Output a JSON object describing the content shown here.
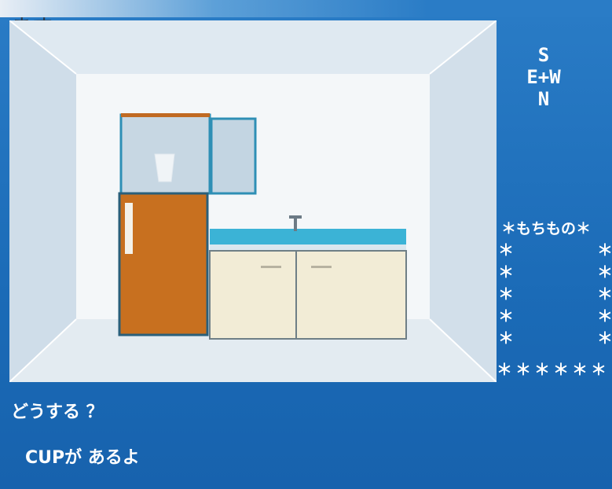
{
  "header": {
    "text": "ます。"
  },
  "compass": {
    "top": "S",
    "middle": "E+W",
    "bottom": "N"
  },
  "inventory": {
    "title": "＊もちもの＊",
    "star": "＊",
    "bottom": "＊＊＊＊＊＊"
  },
  "messages": {
    "prompt": "どうする ？",
    "result": "CUPが あるよ"
  },
  "colors": {
    "screen_blue": "#1f6fb8",
    "wall": "#f3f6f8",
    "floor": "#dfe7ee",
    "fridge_orange": "#c8701f",
    "counter_top": "#3bb3d6",
    "cabinet": "#f2ecd6"
  }
}
